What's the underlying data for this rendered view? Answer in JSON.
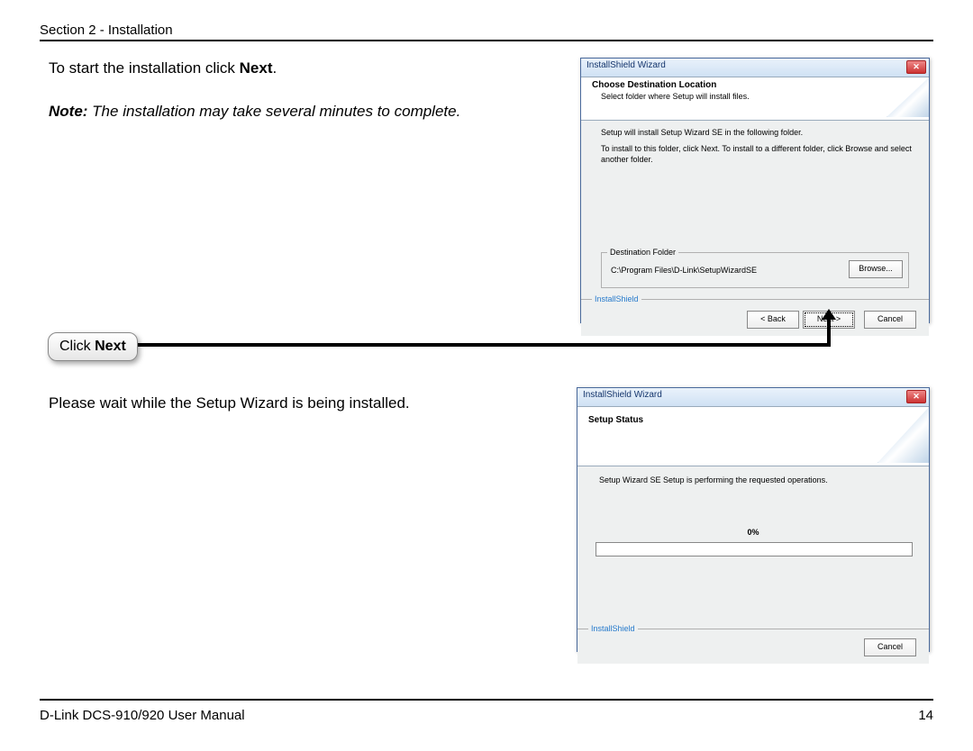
{
  "header": {
    "section": "Section 2 - Installation"
  },
  "footer": {
    "manual": "D-Link DCS-910/920 User Manual",
    "page_no": "14"
  },
  "body": {
    "start_text_pre": "To start the installation click ",
    "start_text_bold": "Next",
    "start_text_post": ".",
    "note_bold": "Note:",
    "note_rest": " The installation may take several minutes to complete.",
    "wait_text": "Please wait while the Setup Wizard is being installed."
  },
  "callout": {
    "click_pre": "Click ",
    "click_bold": "Next"
  },
  "dialog1": {
    "title": "InstallShield Wizard",
    "h_title": "Choose Destination Location",
    "h_sub": "Select folder where Setup will install files.",
    "body_line1": "Setup will install Setup Wizard SE in the following folder.",
    "body_line2": "To install to this folder, click Next. To install to a different folder, click Browse and select another folder.",
    "fs_label": "Destination Folder",
    "dest_path": "C:\\Program Files\\D-Link\\SetupWizardSE",
    "browse": "Browse...",
    "is_label": "InstallShield",
    "back": "< Back",
    "next": "Next >",
    "cancel": "Cancel"
  },
  "dialog2": {
    "title": "InstallShield Wizard",
    "h_title": "Setup Status",
    "body_line": "Setup Wizard SE Setup is performing the requested operations.",
    "pct": "0%",
    "is_label": "InstallShield",
    "cancel": "Cancel"
  }
}
